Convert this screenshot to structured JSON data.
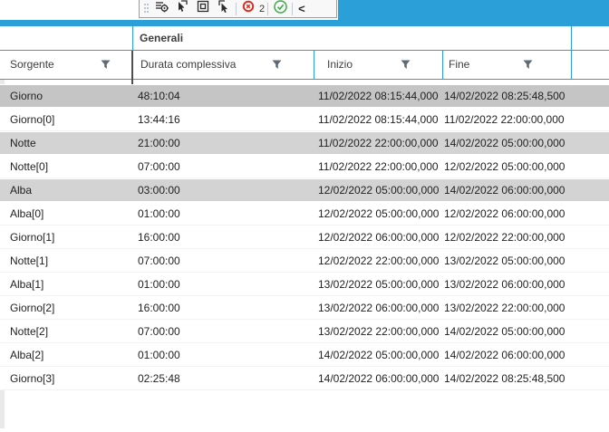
{
  "colors": {
    "accent_blue": "#2a9fd8",
    "titlebar_dash_blue": "#86cdf0",
    "parent_row_gray": "#d3d3d3",
    "selected_row_gray": "#c5c5c5",
    "frozen_divider_gray": "#4f4f4f",
    "record_red": "#d93025",
    "check_green": "#3bab46"
  },
  "toolbar": {
    "buttons": [
      {
        "icon": "list-target-icon"
      },
      {
        "icon": "cursor-flag-icon"
      },
      {
        "icon": "square-in-square-icon"
      },
      {
        "icon": "cursor-bracket-icon"
      }
    ],
    "badge_count": "2",
    "chevron_label": "<"
  },
  "table": {
    "group_header": "Generali",
    "columns": [
      {
        "label": "Sorgente"
      },
      {
        "label": "Durata complessiva"
      },
      {
        "label": "Inizio"
      },
      {
        "label": "Fine"
      }
    ],
    "rows": [
      {
        "sorgente": "Giorno",
        "durata": "48:10:04",
        "inizio": "11/02/2022 08:15:44,000",
        "fine": "14/02/2022 08:25:48,500",
        "kind": "selected"
      },
      {
        "sorgente": "Giorno[0]",
        "durata": "13:44:16",
        "inizio": "11/02/2022 08:15:44,000",
        "fine": "11/02/2022 22:00:00,000",
        "kind": "child"
      },
      {
        "sorgente": "Notte",
        "durata": "21:00:00",
        "inizio": "11/02/2022 22:00:00,000",
        "fine": "14/02/2022 05:00:00,000",
        "kind": "parent"
      },
      {
        "sorgente": "Notte[0]",
        "durata": "07:00:00",
        "inizio": "11/02/2022 22:00:00,000",
        "fine": "12/02/2022 05:00:00,000",
        "kind": "child"
      },
      {
        "sorgente": "Alba",
        "durata": "03:00:00",
        "inizio": "12/02/2022 05:00:00,000",
        "fine": "14/02/2022 06:00:00,000",
        "kind": "parent"
      },
      {
        "sorgente": "Alba[0]",
        "durata": "01:00:00",
        "inizio": "12/02/2022 05:00:00,000",
        "fine": "12/02/2022 06:00:00,000",
        "kind": "child"
      },
      {
        "sorgente": "Giorno[1]",
        "durata": "16:00:00",
        "inizio": "12/02/2022 06:00:00,000",
        "fine": "12/02/2022 22:00:00,000",
        "kind": "child"
      },
      {
        "sorgente": "Notte[1]",
        "durata": "07:00:00",
        "inizio": "12/02/2022 22:00:00,000",
        "fine": "13/02/2022 05:00:00,000",
        "kind": "child"
      },
      {
        "sorgente": "Alba[1]",
        "durata": "01:00:00",
        "inizio": "13/02/2022 05:00:00,000",
        "fine": "13/02/2022 06:00:00,000",
        "kind": "child"
      },
      {
        "sorgente": "Giorno[2]",
        "durata": "16:00:00",
        "inizio": "13/02/2022 06:00:00,000",
        "fine": "13/02/2022 22:00:00,000",
        "kind": "child"
      },
      {
        "sorgente": "Notte[2]",
        "durata": "07:00:00",
        "inizio": "13/02/2022 22:00:00,000",
        "fine": "14/02/2022 05:00:00,000",
        "kind": "child"
      },
      {
        "sorgente": "Alba[2]",
        "durata": "01:00:00",
        "inizio": "14/02/2022 05:00:00,000",
        "fine": "14/02/2022 06:00:00,000",
        "kind": "child"
      },
      {
        "sorgente": "Giorno[3]",
        "durata": "02:25:48",
        "inizio": "14/02/2022 06:00:00,000",
        "fine": "14/02/2022 08:25:48,500",
        "kind": "child"
      }
    ]
  }
}
